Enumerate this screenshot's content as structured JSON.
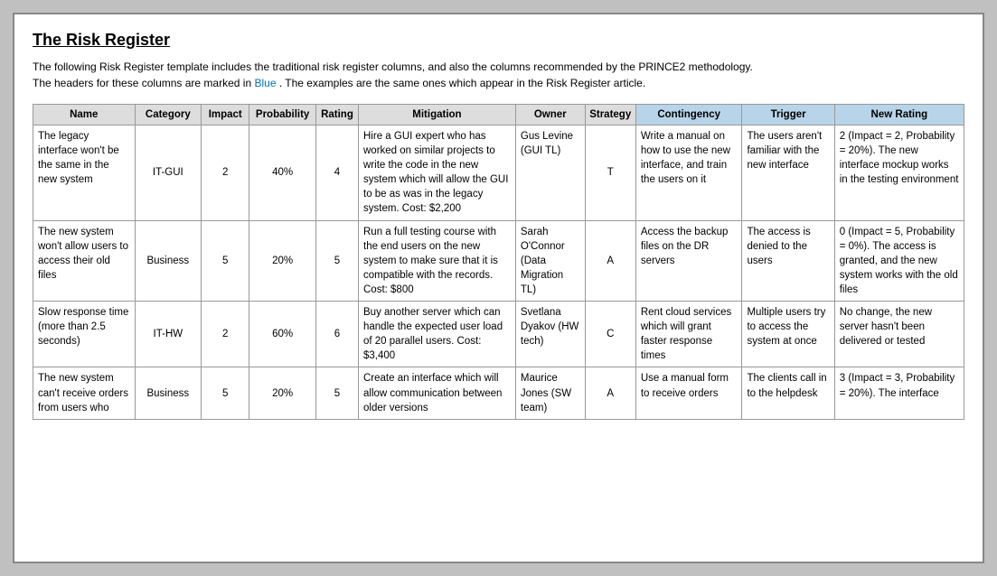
{
  "title": "The Risk Register",
  "description_line1": "The following Risk Register template includes the traditional risk register columns, and also the columns recommended by the PRINCE2 methodology.",
  "description_line2": "The headers for these columns are marked in",
  "description_blue": "Blue",
  "description_line2b": ". The examples are the same ones which appear in the Risk Register article.",
  "headers": {
    "name": "Name",
    "category": "Category",
    "impact": "Impact",
    "probability": "Probability",
    "rating": "Rating",
    "mitigation": "Mitigation",
    "owner": "Owner",
    "strategy": "Strategy",
    "contingency": "Contingency",
    "trigger": "Trigger",
    "new_rating": "New Rating"
  },
  "rows": [
    {
      "name": "The legacy interface won't be the same in the new system",
      "category": "IT-GUI",
      "impact": "2",
      "probability": "40%",
      "rating": "4",
      "mitigation": "Hire a GUI expert who has worked on similar projects to write the code in the new system which will allow the GUI to be as was in the legacy system. Cost: $2,200",
      "owner": "Gus Levine (GUI TL)",
      "strategy": "T",
      "contingency": "Write a manual on how to use the new interface, and train the users on it",
      "trigger": "The users aren't familiar with the new interface",
      "new_rating": "2 (Impact = 2, Probability = 20%). The new interface mockup works in the testing environment"
    },
    {
      "name": "The new system won't allow users to access their old files",
      "category": "Business",
      "impact": "5",
      "probability": "20%",
      "rating": "5",
      "mitigation": "Run a full testing course with the end users on the new system to make sure that it is compatible with the records. Cost: $800",
      "owner": "Sarah O'Connor (Data Migration TL)",
      "strategy": "A",
      "contingency": "Access the backup files on the DR servers",
      "trigger": "The access is denied to the users",
      "new_rating": "0 (Impact = 5, Probability = 0%). The access is granted, and the new system works with the old files"
    },
    {
      "name": "Slow response time (more than 2.5 seconds)",
      "category": "IT-HW",
      "impact": "2",
      "probability": "60%",
      "rating": "6",
      "mitigation": "Buy another server which can handle the expected user load of 20 parallel users. Cost: $3,400",
      "owner": "Svetlana Dyakov (HW tech)",
      "strategy": "C",
      "contingency": "Rent cloud services which will grant faster response times",
      "trigger": "Multiple users try to access the system at once",
      "new_rating": "No change, the new server hasn't been delivered or tested"
    },
    {
      "name": "The new system can't receive orders from users who",
      "category": "Business",
      "impact": "5",
      "probability": "20%",
      "rating": "5",
      "mitigation": "Create an interface which will allow communication between older versions",
      "owner": "Maurice Jones (SW team)",
      "strategy": "A",
      "contingency": "Use a manual form to receive orders",
      "trigger": "The clients call in to the helpdesk",
      "new_rating": "3 (Impact = 3, Probability = 20%). The interface"
    }
  ]
}
